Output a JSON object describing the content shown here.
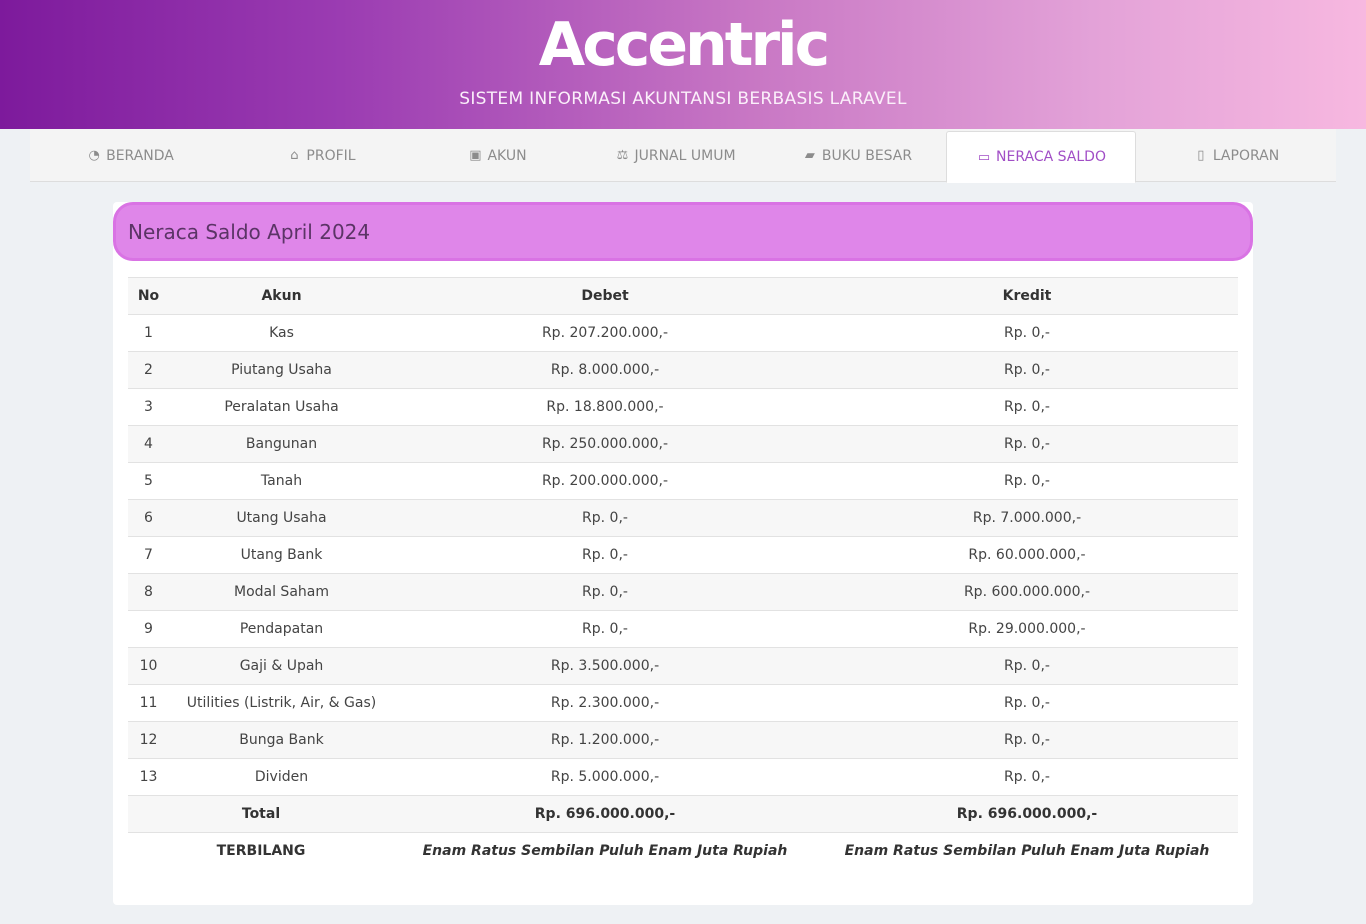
{
  "header": {
    "brand": "Accentric",
    "tagline": "SISTEM INFORMASI AKUNTANSI BERBASIS LARAVEL"
  },
  "nav": {
    "items": [
      {
        "label": "BERANDA",
        "icon": "dashboard-icon",
        "glyph": "◔"
      },
      {
        "label": "PROFIL",
        "icon": "bank-icon",
        "glyph": "⌂"
      },
      {
        "label": "AKUN",
        "icon": "address-book-icon",
        "glyph": "▣"
      },
      {
        "label": "JURNAL UMUM",
        "icon": "balance-scale-icon",
        "glyph": "⚖"
      },
      {
        "label": "BUKU BESAR",
        "icon": "book-icon",
        "glyph": "▰"
      },
      {
        "label": "NERACA SALDO",
        "icon": "money-icon",
        "glyph": "▭"
      },
      {
        "label": "LAPORAN",
        "icon": "file-pdf-icon",
        "glyph": "▯"
      }
    ],
    "active": "NERACA SALDO",
    "active_color": "#a14ec6"
  },
  "card": {
    "title": "Neraca Saldo April 2024"
  },
  "table": {
    "headers": {
      "no": "No",
      "akun": "Akun",
      "debet": "Debet",
      "kredit": "Kredit"
    },
    "rows": [
      {
        "no": "1",
        "akun": "Kas",
        "debet": "Rp. 207.200.000,-",
        "kredit": "Rp. 0,-"
      },
      {
        "no": "2",
        "akun": "Piutang Usaha",
        "debet": "Rp. 8.000.000,-",
        "kredit": "Rp. 0,-"
      },
      {
        "no": "3",
        "akun": "Peralatan Usaha",
        "debet": "Rp. 18.800.000,-",
        "kredit": "Rp. 0,-"
      },
      {
        "no": "4",
        "akun": "Bangunan",
        "debet": "Rp. 250.000.000,-",
        "kredit": "Rp. 0,-"
      },
      {
        "no": "5",
        "akun": "Tanah",
        "debet": "Rp. 200.000.000,-",
        "kredit": "Rp. 0,-"
      },
      {
        "no": "6",
        "akun": "Utang Usaha",
        "debet": "Rp. 0,-",
        "kredit": "Rp. 7.000.000,-"
      },
      {
        "no": "7",
        "akun": "Utang Bank",
        "debet": "Rp. 0,-",
        "kredit": "Rp. 60.000.000,-"
      },
      {
        "no": "8",
        "akun": "Modal Saham",
        "debet": "Rp. 0,-",
        "kredit": "Rp. 600.000.000,-"
      },
      {
        "no": "9",
        "akun": "Pendapatan",
        "debet": "Rp. 0,-",
        "kredit": "Rp. 29.000.000,-"
      },
      {
        "no": "10",
        "akun": "Gaji & Upah",
        "debet": "Rp. 3.500.000,-",
        "kredit": "Rp. 0,-"
      },
      {
        "no": "11",
        "akun": "Utilities (Listrik, Air, & Gas)",
        "debet": "Rp. 2.300.000,-",
        "kredit": "Rp. 0,-"
      },
      {
        "no": "12",
        "akun": "Bunga Bank",
        "debet": "Rp. 1.200.000,-",
        "kredit": "Rp. 0,-"
      },
      {
        "no": "13",
        "akun": "Dividen",
        "debet": "Rp. 5.000.000,-",
        "kredit": "Rp. 0,-"
      }
    ],
    "total": {
      "label": "Total",
      "debet": "Rp. 696.000.000,-",
      "kredit": "Rp. 696.000.000,-"
    },
    "terbilang": {
      "label": "TERBILANG",
      "debet": "Enam Ratus Sembilan Puluh Enam Juta Rupiah",
      "kredit": "Enam Ratus Sembilan Puluh Enam Juta Rupiah"
    }
  }
}
